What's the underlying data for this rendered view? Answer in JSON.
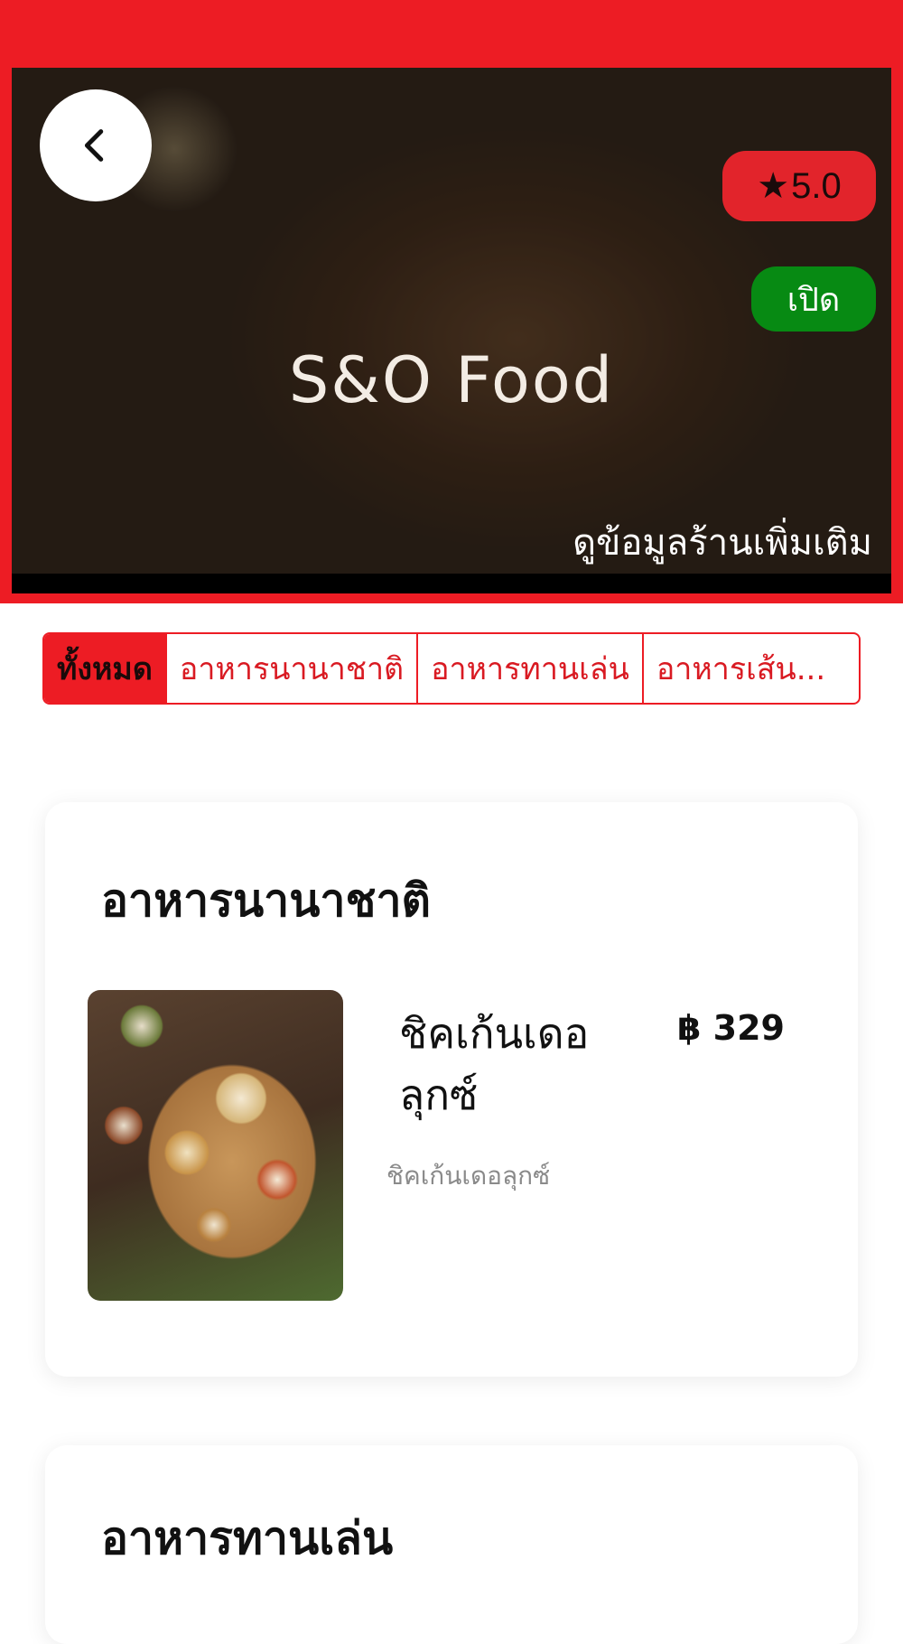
{
  "header": {
    "store_name": "S&O Food",
    "rating": "5.0",
    "rating_icon": "★",
    "status_label": "เปิด",
    "more_info_link": "ดูข้อมูลร้านเพิ่มเติม"
  },
  "tabs": [
    {
      "label": "ทั้งหมด",
      "active": true
    },
    {
      "label": "อาหารนานาชาติ",
      "active": false
    },
    {
      "label": "อาหารทานเล่น",
      "active": false
    },
    {
      "label": "อาหารเส้น...",
      "active": false
    }
  ],
  "sections": [
    {
      "title": "อาหารนานาชาติ",
      "items": [
        {
          "name": "ชิคเก้นเดอลุกซ์",
          "price": "฿ 329",
          "description": "ชิคเก้นเดอลุกซ์"
        }
      ]
    },
    {
      "title": "อาหารทานเล่น",
      "items": []
    }
  ],
  "colors": {
    "brand_red": "#ed1c24",
    "open_green": "#078a13"
  },
  "icons": {
    "back": "chevron-left-icon",
    "star": "star-icon"
  }
}
